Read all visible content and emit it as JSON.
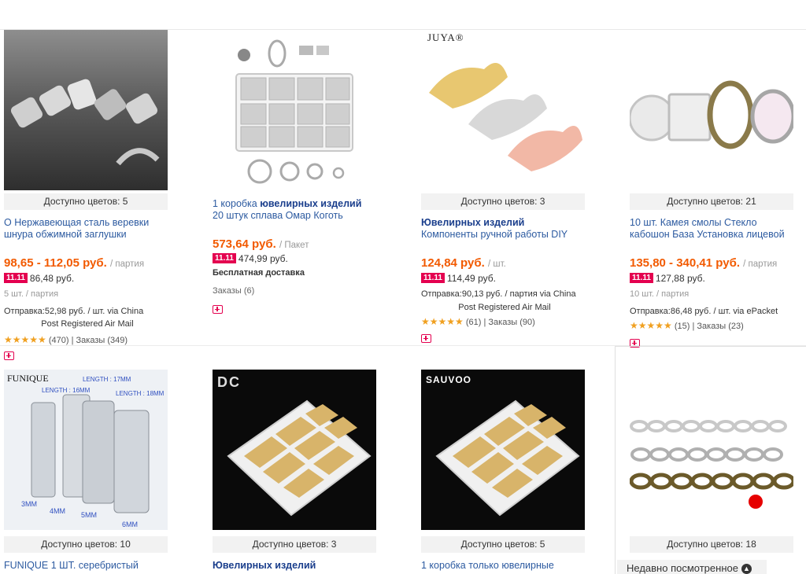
{
  "products": [
    {
      "avail": "Доступно цветов: 5",
      "title_plain": "О Нержавеющая сталь веревки шнура обжимной заглушки",
      "price": "98,65 - 112,05 руб.",
      "unit": "/ партия",
      "promo_tag": "11.11",
      "promo_price": "86,48 руб.",
      "lot": "5 шт. / партия",
      "ship_line1": "Отправка:52,98 руб. / шт. via China",
      "ship_line2": "Post Registered Air Mail",
      "stars": "★★★★★",
      "rating": "(470) | Заказы (349)"
    },
    {
      "title_pre": "1 коробка",
      "title_bold": "ювелирных изделий",
      "title_post": "20 штук сплава Омар Коготь",
      "price": "573,64 руб.",
      "unit": "/ Пакет",
      "promo_tag": "11.11",
      "promo_price": "474,99 руб.",
      "free": "Бесплатная доставка",
      "orders": "Заказы (6)"
    },
    {
      "brand": "JUYA®",
      "avail": "Доступно цветов: 3",
      "title_bold": "Ювелирных изделий",
      "title_post": "Компоненты ручной работы DIY",
      "price": "124,84 руб.",
      "unit": "/ шт.",
      "promo_tag": "11.11",
      "promo_price": "114,49 руб.",
      "ship_line1": "Отправка:90,13 руб. / партия via China",
      "ship_line2": "Post Registered Air Mail",
      "stars": "★★★★★",
      "rating": "(61) | Заказы (90)"
    },
    {
      "avail": "Доступно цветов: 21",
      "title_plain": "10 шт. Камея смолы Стекло кабошон База Установка лицевой",
      "price": "135,80 - 340,41 руб.",
      "unit": "/ партия",
      "promo_tag": "11.11",
      "promo_price": "127,88 руб.",
      "lot": "10 шт. / партия",
      "ship_line1": "Отправка:86,48 руб. / шт. via ePacket",
      "stars": "★★★★★",
      "rating": "(15) | Заказы (23)"
    },
    {
      "brand": "FUNIQUE",
      "avail": "Доступно цветов: 10",
      "title_plain": "FUNIQUE 1 ШТ. серебристый",
      "img_labels": [
        "LENGTH : 16MM",
        "LENGTH : 17MM",
        "LENGTH : 18MM",
        "3MM",
        "4MM",
        "5MM",
        "6MM"
      ]
    },
    {
      "brand": "DC",
      "avail": "Доступно цветов: 3",
      "title_bold": "Ювелирных изделий"
    },
    {
      "brand": "SAUVOO",
      "avail": "Доступно цветов: 5",
      "title_plain": "1 коробка только ювелирные"
    },
    {
      "avail": "Доступно цветов: 18"
    }
  ],
  "recent": {
    "label": "Недавно посмотренное"
  }
}
